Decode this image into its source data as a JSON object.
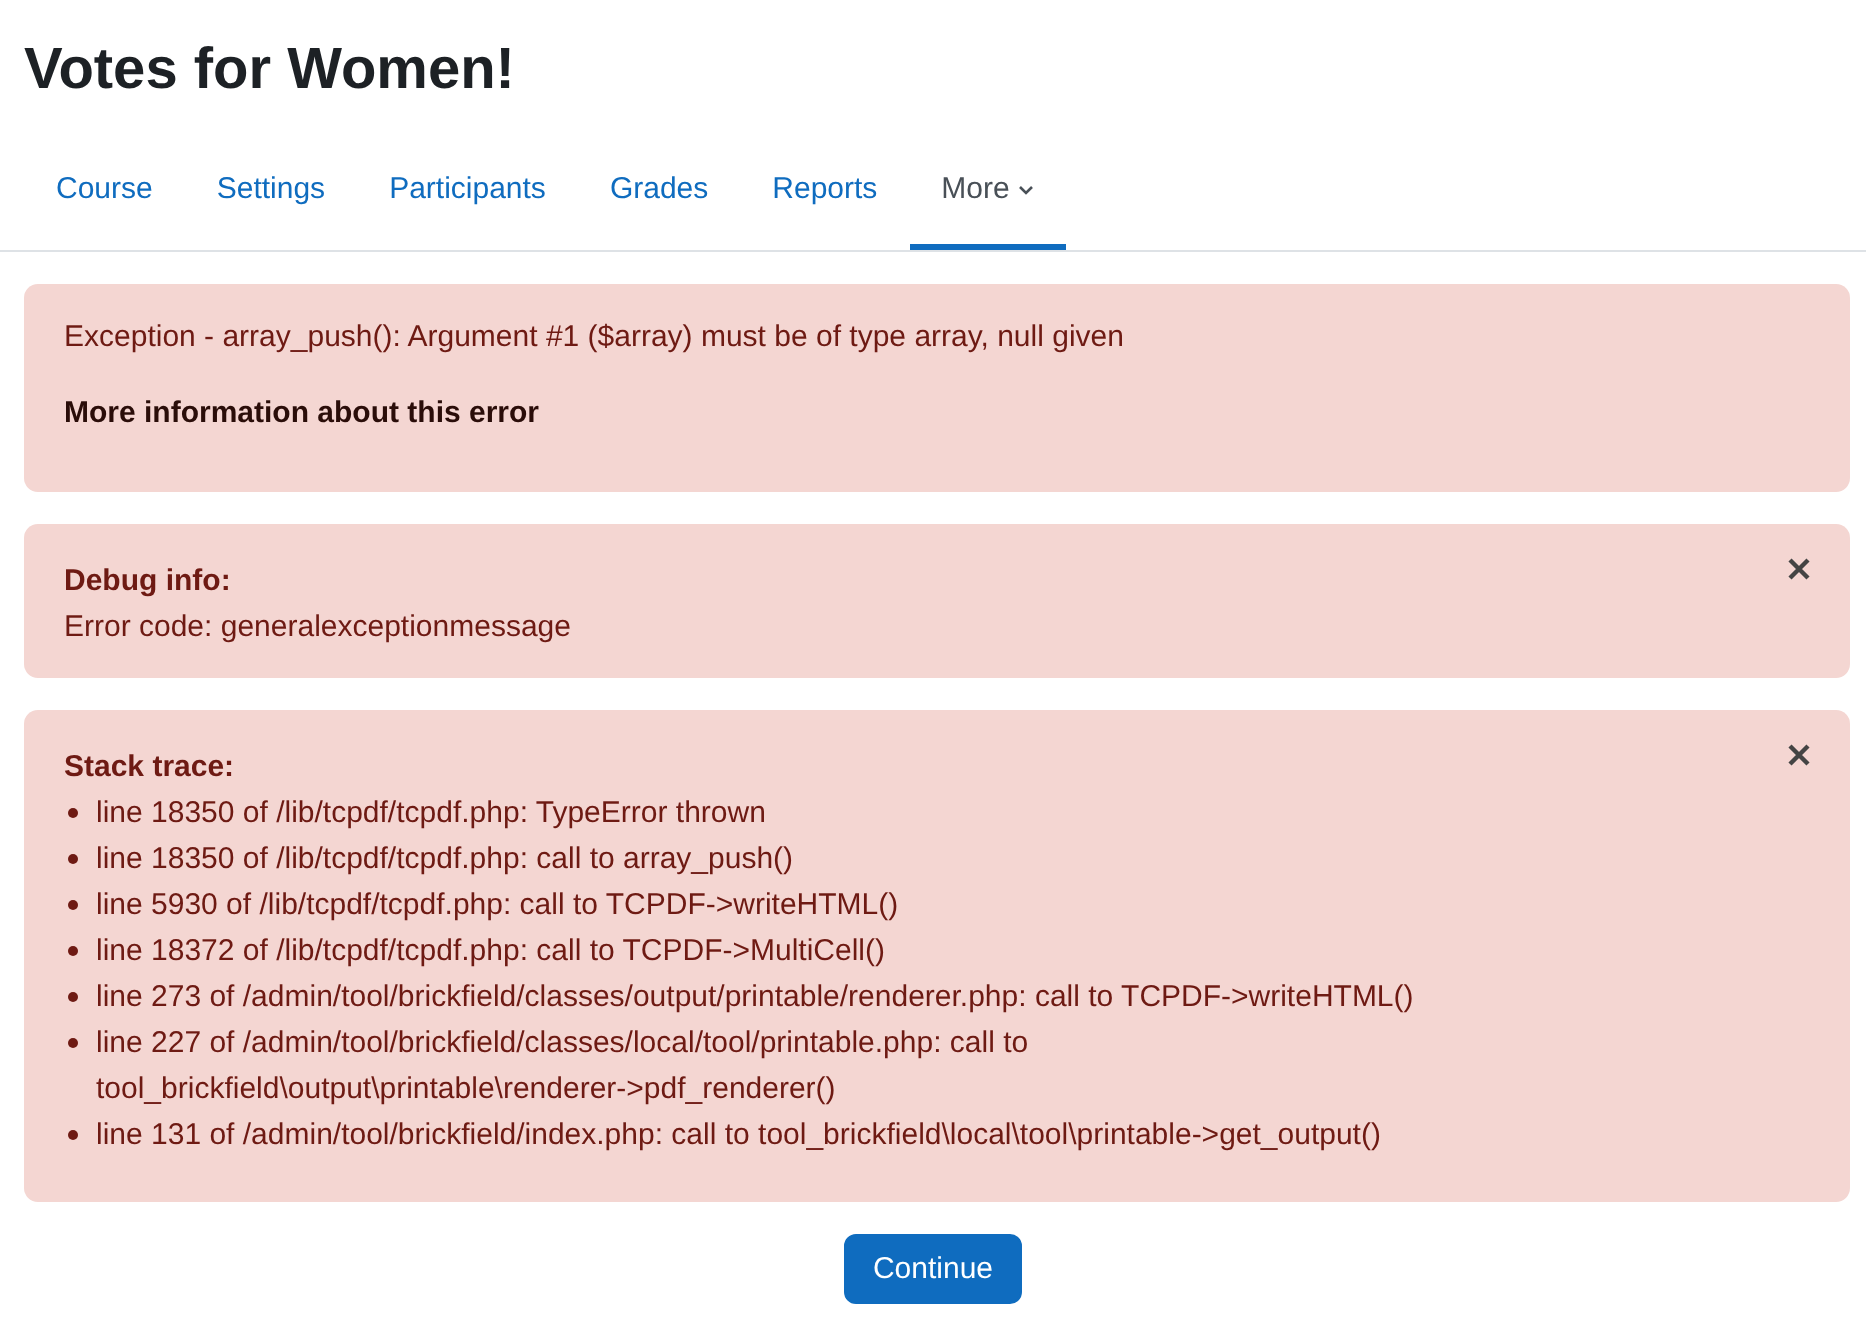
{
  "page_title": "Votes for Women!",
  "tabs": [
    {
      "label": "Course",
      "selected": false,
      "dropdown": false
    },
    {
      "label": "Settings",
      "selected": false,
      "dropdown": false
    },
    {
      "label": "Participants",
      "selected": false,
      "dropdown": false
    },
    {
      "label": "Grades",
      "selected": false,
      "dropdown": false
    },
    {
      "label": "Reports",
      "selected": false,
      "dropdown": false
    },
    {
      "label": "More",
      "selected": true,
      "dropdown": true
    }
  ],
  "error_alert": {
    "message": "Exception - array_push(): Argument #1 ($array) must be of type array, null given",
    "more_info_link": "More information about this error"
  },
  "debug_alert": {
    "heading": "Debug info:",
    "text": "Error code: generalexceptionmessage",
    "dismissible": true
  },
  "stack_alert": {
    "heading": "Stack trace:",
    "dismissible": true,
    "lines": [
      "line 18350 of /lib/tcpdf/tcpdf.php: TypeError thrown",
      "line 18350 of /lib/tcpdf/tcpdf.php: call to array_push()",
      "line 5930 of /lib/tcpdf/tcpdf.php: call to TCPDF->writeHTML()",
      "line 18372 of /lib/tcpdf/tcpdf.php: call to TCPDF->MultiCell()",
      "line 273 of /admin/tool/brickfield/classes/output/printable/renderer.php: call to TCPDF->writeHTML()",
      "line 227 of /admin/tool/brickfield/classes/local/tool/printable.php: call to tool_brickfield\\output\\printable\\renderer->pdf_renderer()",
      "line 131 of /admin/tool/brickfield/index.php: call to tool_brickfield\\local\\tool\\printable->get_output()"
    ]
  },
  "continue_button": "Continue"
}
